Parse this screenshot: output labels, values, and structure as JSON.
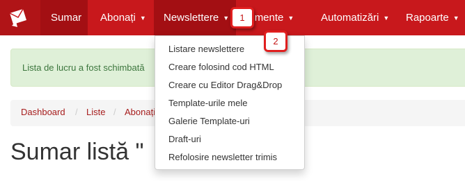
{
  "navbar": {
    "logo_icon": "envelope-logo-icon",
    "items": [
      {
        "label": "Sumar",
        "caret": ""
      },
      {
        "label": "Abonați",
        "caret": "▼"
      },
      {
        "label": "Newslettere",
        "caret": "▼"
      },
      {
        "label": "Segmente",
        "caret": "▼"
      },
      {
        "label": "Automatizări",
        "caret": "▼"
      },
      {
        "label": "Rapoarte",
        "caret": "▼"
      }
    ]
  },
  "alert": {
    "text": "Lista de lucru a fost schimbată"
  },
  "breadcrumb": {
    "items": [
      "Dashboard",
      "Liste",
      "Abonați"
    ],
    "separator": "/"
  },
  "page": {
    "title": "Sumar listă \""
  },
  "newsletter_menu": {
    "items": [
      "Listare newslettere",
      "Creare folosind cod HTML",
      "Creare cu Editor Drag&Drop",
      "Template-urile mele",
      "Galerie Template-uri",
      "Draft-uri",
      "Refolosire newsletter trimis"
    ]
  },
  "annotations": {
    "badge_1": "1",
    "badge_2": "2"
  },
  "colors": {
    "navbar": "#c8181c",
    "navbar_active": "#a30f13",
    "alert_bg": "#dff0d8",
    "alert_text": "#3c763d",
    "link": "#a61c1c",
    "badge_border": "#e01e1e"
  }
}
